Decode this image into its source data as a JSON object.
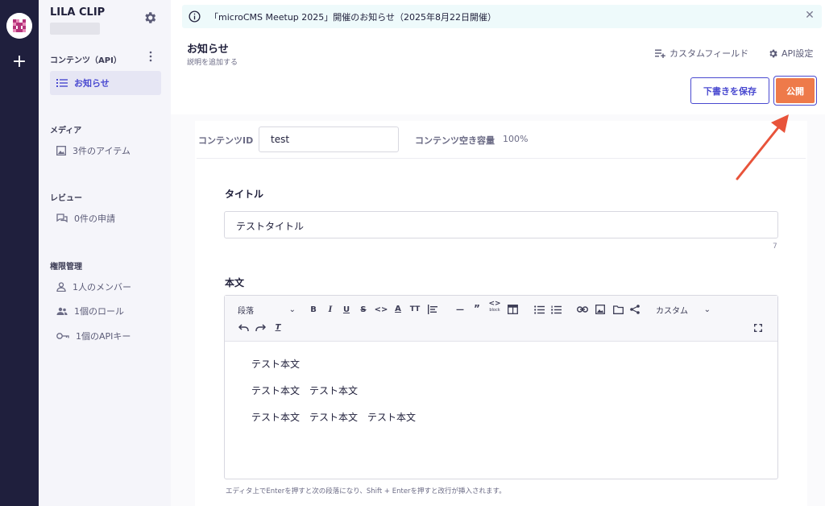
{
  "service": {
    "name": "LILA CLIP"
  },
  "sidebar": {
    "contents_heading": "コンテンツ（API）",
    "contents_items": [
      {
        "label": "お知らせ",
        "icon": "list-icon",
        "active": true
      }
    ],
    "media_heading": "メディア",
    "media_items": [
      {
        "label": "3件のアイテム",
        "icon": "image-icon"
      }
    ],
    "review_heading": "レビュー",
    "review_items": [
      {
        "label": "0件の申請",
        "icon": "chat-icon"
      }
    ],
    "permission_heading": "権限管理",
    "permission_items": [
      {
        "label": "1人のメンバー",
        "icon": "person-icon"
      },
      {
        "label": "1個のロール",
        "icon": "people-icon"
      },
      {
        "label": "1個のAPIキー",
        "icon": "key-icon"
      }
    ]
  },
  "banner": {
    "text": "「microCMS Meetup 2025」開催のお知らせ（2025年8月22日開催）"
  },
  "header": {
    "title": "お知らせ",
    "description": "説明を追加する",
    "custom_field_label": "カスタムフィールド",
    "api_settings_label": "API設定",
    "save_draft_label": "下書きを保存",
    "publish_label": "公開"
  },
  "meta": {
    "content_id_label": "コンテンツID",
    "content_id_value": "test",
    "capacity_label": "コンテンツ空き容量",
    "capacity_value": "100%"
  },
  "fields": {
    "title_label": "タイトル",
    "title_value": "テストタイトル",
    "title_count": "7",
    "body_label": "本文",
    "toolbar": {
      "paragraph": "段落",
      "custom": "カスタム",
      "code_block_small": "block"
    },
    "body_lines": [
      "テスト本文",
      "テスト本文　テスト本文",
      "テスト本文　テスト本文　テスト本文"
    ],
    "hint": "エディタ上でEnterを押すと次の段落になり、Shift + Enterを押すと改行が挿入されます。"
  },
  "colors": {
    "rail": "#1f1f3d",
    "accent": "#4a4ad0",
    "publish": "#ee7a4a",
    "arrow": "#e8533a"
  }
}
